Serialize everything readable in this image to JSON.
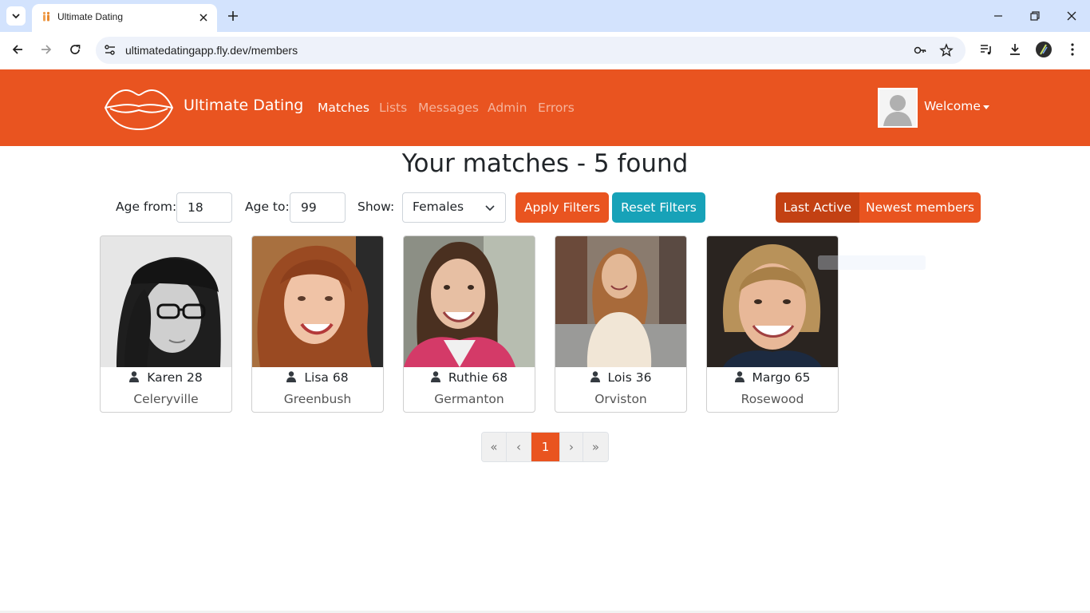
{
  "browser": {
    "tab_title": "Ultimate Dating",
    "url": "ultimatedatingapp.fly.dev/members"
  },
  "nav": {
    "brand": "Ultimate Dating",
    "links": [
      "Matches",
      "Lists",
      "Messages",
      "Admin",
      "Errors"
    ],
    "active": "Matches",
    "welcome": "Welcome"
  },
  "page": {
    "heading": "Your matches - 5 found"
  },
  "filters": {
    "age_from_label": "Age from:",
    "age_from": "18",
    "age_to_label": "Age to:",
    "age_to": "99",
    "show_label": "Show:",
    "show_value": "Females",
    "apply_label": "Apply Filters",
    "reset_label": "Reset Filters",
    "sort_options": [
      "Last Active",
      "Newest members"
    ],
    "sort_selected": "Last Active"
  },
  "members": [
    {
      "name": "Karen 28",
      "city": "Celeryville"
    },
    {
      "name": "Lisa 68",
      "city": "Greenbush"
    },
    {
      "name": "Ruthie 68",
      "city": "Germanton"
    },
    {
      "name": "Lois 36",
      "city": "Orviston"
    },
    {
      "name": "Margo 65",
      "city": "Rosewood"
    }
  ],
  "pagination": {
    "first": "«",
    "prev": "‹",
    "current": "1",
    "next": "›",
    "last": "»"
  },
  "colors": {
    "primary": "#e95420",
    "primary_dark": "#c34113",
    "info": "#17a2b8"
  }
}
